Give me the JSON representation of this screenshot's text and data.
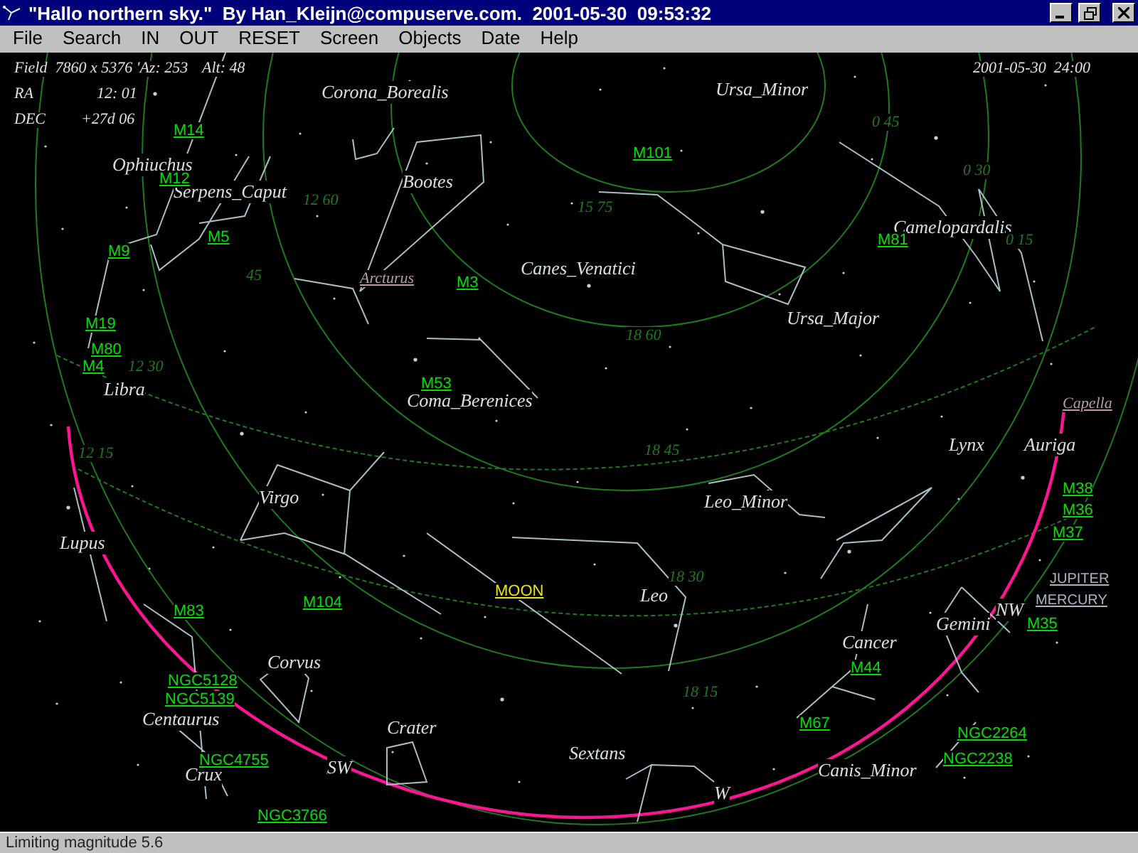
{
  "window": {
    "title": "\"Hallo northern sky.\"  By Han_Kleijn@compuserve.com.  2001-05-30  09:53:32"
  },
  "menu": [
    "File",
    "Search",
    "IN",
    "OUT",
    "RESET",
    "Screen",
    "Objects",
    "Date",
    "Help"
  ],
  "info": {
    "field": "Field  7860 x 5376 'Az: 253",
    "alt": "Alt: 48",
    "ra_label": "RA",
    "ra": "12: 01",
    "dec_label": "DEC",
    "dec": "+27d 06",
    "date_time": "2001-05-30  24:00"
  },
  "sky_map": {
    "labels": [
      {
        "kind": "constellation",
        "text": "Corona_Borealis"
      },
      {
        "kind": "constellation",
        "text": "Ursa_Minor"
      },
      {
        "kind": "constellation",
        "text": "Ophiuchus"
      },
      {
        "kind": "constellation",
        "text": "Serpens_Caput"
      },
      {
        "kind": "constellation",
        "text": "Bootes"
      },
      {
        "kind": "constellation",
        "text": "Canes_Venatici"
      },
      {
        "kind": "constellation",
        "text": "Camelopardalis"
      },
      {
        "kind": "constellation",
        "text": "Ursa_Major"
      },
      {
        "kind": "constellation",
        "text": "Coma_Berenices"
      },
      {
        "kind": "constellation",
        "text": "Libra"
      },
      {
        "kind": "constellation",
        "text": "Lynx"
      },
      {
        "kind": "constellation",
        "text": "Auriga"
      },
      {
        "kind": "constellation",
        "text": "Virgo"
      },
      {
        "kind": "constellation",
        "text": "Leo_Minor"
      },
      {
        "kind": "constellation",
        "text": "Lupus"
      },
      {
        "kind": "constellation",
        "text": "Leo"
      },
      {
        "kind": "constellation",
        "text": "Cancer"
      },
      {
        "kind": "constellation",
        "text": "Gemini"
      },
      {
        "kind": "constellation",
        "text": "Corvus"
      },
      {
        "kind": "constellation",
        "text": "Centaurus"
      },
      {
        "kind": "constellation",
        "text": "Crater"
      },
      {
        "kind": "constellation",
        "text": "Sextans"
      },
      {
        "kind": "constellation",
        "text": "Crux"
      },
      {
        "kind": "constellation",
        "text": "Canis_Minor"
      },
      {
        "kind": "object",
        "text": "M14"
      },
      {
        "kind": "object",
        "text": "M12"
      },
      {
        "kind": "object",
        "text": "M9"
      },
      {
        "kind": "object",
        "text": "M5"
      },
      {
        "kind": "object",
        "text": "M3"
      },
      {
        "kind": "object",
        "text": "M101"
      },
      {
        "kind": "object",
        "text": "M81"
      },
      {
        "kind": "object",
        "text": "M19"
      },
      {
        "kind": "object",
        "text": "M80"
      },
      {
        "kind": "object",
        "text": "M4"
      },
      {
        "kind": "object",
        "text": "M53"
      },
      {
        "kind": "object",
        "text": "M104"
      },
      {
        "kind": "object",
        "text": "M83"
      },
      {
        "kind": "object",
        "text": "NGC5128"
      },
      {
        "kind": "object",
        "text": "NGC5139"
      },
      {
        "kind": "object",
        "text": "NGC4755"
      },
      {
        "kind": "object",
        "text": "NGC3766"
      },
      {
        "kind": "object",
        "text": "M38"
      },
      {
        "kind": "object",
        "text": "M36"
      },
      {
        "kind": "object",
        "text": "M37"
      },
      {
        "kind": "object",
        "text": "M35"
      },
      {
        "kind": "object",
        "text": "M44"
      },
      {
        "kind": "object",
        "text": "M67"
      },
      {
        "kind": "object",
        "text": "NGC2264"
      },
      {
        "kind": "object",
        "text": "NGC2238"
      },
      {
        "kind": "star",
        "text": "Arcturus"
      },
      {
        "kind": "star",
        "text": "Capella"
      },
      {
        "kind": "moon",
        "text": "MOON"
      },
      {
        "kind": "planet",
        "text": "JUPITER"
      },
      {
        "kind": "planet",
        "text": "MERCURY"
      },
      {
        "kind": "compass",
        "text": "SW"
      },
      {
        "kind": "compass",
        "text": "W"
      },
      {
        "kind": "compass",
        "text": "NW"
      },
      {
        "kind": "grid",
        "text": "12 60"
      },
      {
        "kind": "grid",
        "text": "0 45"
      },
      {
        "kind": "grid",
        "text": "18 60"
      },
      {
        "kind": "grid",
        "text": "0 30"
      },
      {
        "kind": "grid",
        "text": "0 15"
      },
      {
        "kind": "grid",
        "text": "45"
      },
      {
        "kind": "grid",
        "text": "12 30"
      },
      {
        "kind": "grid",
        "text": "18 45"
      },
      {
        "kind": "grid",
        "text": "18 30"
      },
      {
        "kind": "grid",
        "text": "18 15"
      },
      {
        "kind": "grid",
        "text": "12 15"
      },
      {
        "kind": "grid",
        "text": "15 75"
      }
    ]
  },
  "status_bar": "Limiting magnitude 5.6"
}
